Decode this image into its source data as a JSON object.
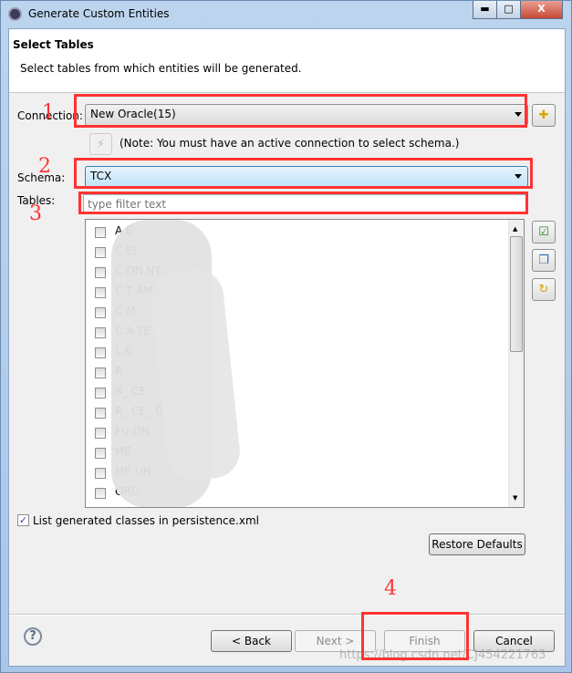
{
  "window": {
    "title": "Generate Custom Entities",
    "controls": [
      "minimize",
      "maximize",
      "close"
    ]
  },
  "header": {
    "title": "Select Tables",
    "description": "Select tables from which entities will be generated."
  },
  "connection": {
    "label": "Connection:",
    "value": "New Oracle(15)"
  },
  "note": "(Note: You must have an active connection to select schema.)",
  "schema": {
    "label": "Schema:",
    "value": "TCX"
  },
  "tables": {
    "label": "Tables:",
    "filter_placeholder": "type filter text",
    "rows": [
      "A        E",
      "C        EL",
      "C      ON     NT",
      "C      T     AME",
      "C      M",
      "C      A    TE",
      "L     K",
      "R",
      "R_      CE",
      "R_      CE_      ORY",
      "FU      ON",
      "ME",
      "ME      UN",
      "ORG"
    ]
  },
  "list_generated": {
    "label": "List generated classes in persistence.xml",
    "checked": true
  },
  "restore_defaults": "Restore Defaults",
  "annotations": [
    "1",
    "2",
    "3",
    "4"
  ],
  "footer": {
    "back": "< Back",
    "next": "Next >",
    "finish": "Finish",
    "cancel": "Cancel"
  },
  "watermark": "https://blog.csdn.net/CJ454221763",
  "colors": {
    "annotation": "#ff3333",
    "schema_selected": "#cde8fb"
  }
}
